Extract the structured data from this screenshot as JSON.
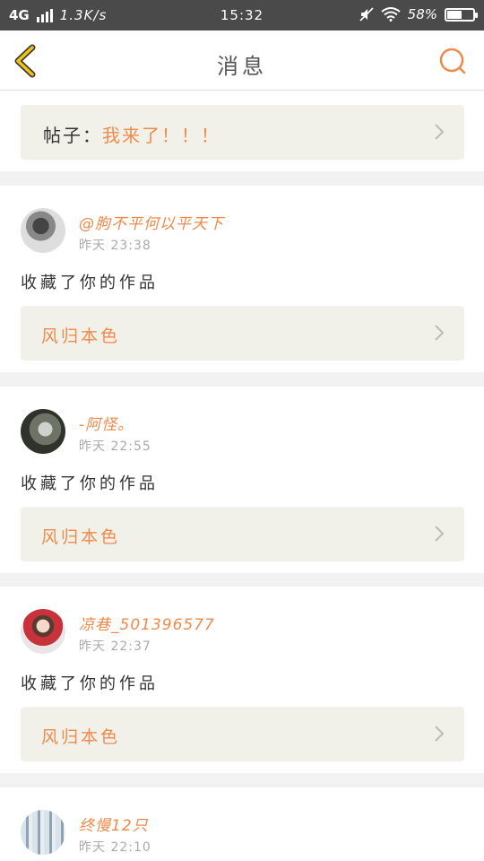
{
  "status_bar": {
    "network": "4G",
    "speed": "1.3K/s",
    "time": "15:32",
    "battery": "58%",
    "battery_level": 0.58
  },
  "header": {
    "title": "消息",
    "back_icon": "chevron-left-icon",
    "search_icon": "search-icon"
  },
  "post": {
    "prefix": "帖子：",
    "title": "我来了！！！"
  },
  "messages": [
    {
      "name": "@朐不平何以平天下",
      "time": "昨天 23:38",
      "action": "收藏了你的作品",
      "work": "风归本色"
    },
    {
      "name": "-阿怪。",
      "time": "昨天 22:55",
      "action": "收藏了你的作品",
      "work": "风归本色"
    },
    {
      "name": "凉巷_501396577",
      "time": "昨天 22:37",
      "action": "收藏了你的作品",
      "work": "风归本色"
    },
    {
      "name": "终慢12只",
      "time": "昨天 22:10"
    }
  ],
  "colors": {
    "accent": "#ef8a4b",
    "back_icon": "#f1c40f",
    "card_bg": "#f1f1ea"
  }
}
